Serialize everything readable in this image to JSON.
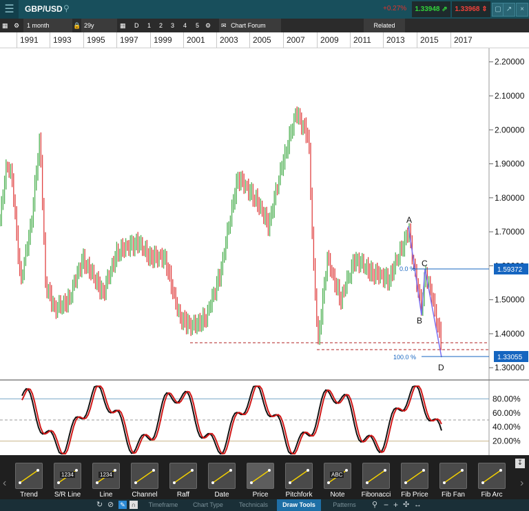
{
  "header": {
    "symbol": "GBP/USD",
    "change": "+0.27%",
    "bid": "1.33948",
    "ask": "1.33968"
  },
  "toolbar": {
    "interval": "1 month",
    "range": "29y",
    "periods": [
      "D",
      "1",
      "2",
      "3",
      "4",
      "5"
    ],
    "chart_forum": "Chart Forum",
    "related": "Related"
  },
  "years": [
    "1991",
    "1993",
    "1995",
    "1997",
    "1999",
    "2001",
    "2003",
    "2005",
    "2007",
    "2009",
    "2011",
    "2013",
    "2015",
    "2017"
  ],
  "chart_data": {
    "type": "candlestick",
    "ylim": [
      1.27,
      2.24
    ],
    "y_ticks": [
      "2.20000",
      "2.10000",
      "2.00000",
      "1.90000",
      "1.80000",
      "1.70000",
      "1.60000",
      "1.50000",
      "1.40000",
      "1.30000"
    ],
    "price_labels": [
      "1.59372",
      "1.33055"
    ],
    "fib_levels": [
      "0.0 %",
      "100.0 %"
    ],
    "wave_labels": [
      "A",
      "B",
      "C",
      "D"
    ],
    "oscillator": {
      "ylim": [
        0,
        100
      ],
      "y_ticks": [
        "80.00%",
        "60.00%",
        "40.00%",
        "20.00%"
      ],
      "levels": [
        80,
        50,
        20
      ]
    },
    "colors": {
      "up": "#4caf50",
      "down": "#e04040",
      "price_label_bg": "#1565c0"
    }
  },
  "draw_tools": [
    {
      "label": "Trend",
      "icon": "trend-icon"
    },
    {
      "label": "S/R Line",
      "icon": "sr-line-icon",
      "tag": "1234"
    },
    {
      "label": "Line",
      "icon": "line-icon",
      "tag": "1234"
    },
    {
      "label": "Channel",
      "icon": "channel-icon"
    },
    {
      "label": "Raff",
      "icon": "raff-icon"
    },
    {
      "label": "Date",
      "icon": "date-icon"
    },
    {
      "label": "Price",
      "icon": "price-icon"
    },
    {
      "label": "Pitchfork",
      "icon": "pitchfork-icon"
    },
    {
      "label": "Note",
      "icon": "note-icon",
      "tag": "ABC"
    },
    {
      "label": "Fibonacci",
      "icon": "fibonacci-icon"
    },
    {
      "label": "Fib Price",
      "icon": "fib-price-icon"
    },
    {
      "label": "Fib Fan",
      "icon": "fib-fan-icon"
    },
    {
      "label": "Fib Arc",
      "icon": "fib-arc-icon"
    }
  ],
  "tabs": [
    "Timeframe",
    "Chart Type",
    "Technicals",
    "Draw Tools",
    "Patterns"
  ],
  "active_tab": "Draw Tools"
}
